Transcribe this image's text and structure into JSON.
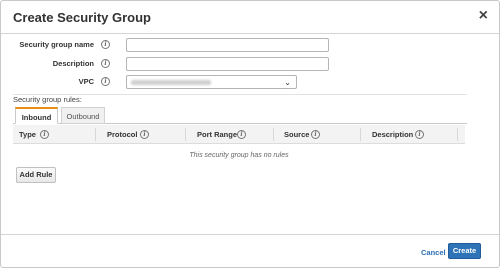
{
  "dialog": {
    "title": "Create Security Group",
    "close_glyph": "×"
  },
  "form": {
    "name_label": "Security group name",
    "name_value": "",
    "description_label": "Description",
    "description_value": "",
    "vpc_label": "VPC",
    "vpc_selected": ""
  },
  "icons": {
    "info": "i",
    "chevron": "⌄"
  },
  "rules": {
    "section_label": "Security group rules:",
    "tabs": [
      {
        "label": "Inbound",
        "active": true
      },
      {
        "label": "Outbound",
        "active": false
      }
    ],
    "columns": [
      "Type",
      "Protocol",
      "Port Range",
      "Source",
      "Description"
    ],
    "empty_message": "This security group has no rules",
    "add_rule_label": "Add Rule"
  },
  "footer": {
    "cancel_label": "Cancel",
    "create_label": "Create"
  },
  "colors": {
    "primary": "#2e73b8",
    "tab_accent": "#e98e12",
    "link": "#2a6fb8"
  }
}
